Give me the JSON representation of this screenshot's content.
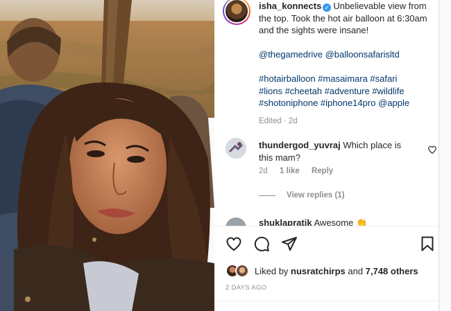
{
  "post": {
    "username": "isha_konnects",
    "verified_badge": "verified-badge-icon",
    "caption_text": "Unbelievable view from the top. Took the hot air balloon at 6:30am and the sights were insane!",
    "mentions": [
      "@thegamedrive",
      "@balloonsafarisltd"
    ],
    "hashtags_line1": "#hotairballoon #masaimara #safari",
    "hashtags_line2": "#lions #cheetah #adventure #wildlife",
    "hashtags_line3_tags": "#shotoniphone #iphone14pro",
    "hashtags_line3_mention": "@apple",
    "edited_meta": "Edited · 2d"
  },
  "comments": [
    {
      "username": "thundergod_yuvraj",
      "text": "Which place is this mam?",
      "age": "2d",
      "likes": "1 like",
      "reply_label": "Reply",
      "view_replies": "View replies (1)"
    },
    {
      "username": "shuklapratik",
      "text": "Awesome 👏"
    }
  ],
  "actions": {
    "like": "heart-icon",
    "comment": "comment-icon",
    "share": "share-icon",
    "save": "bookmark-icon"
  },
  "likes": {
    "prefix": "Liked by",
    "user": "nusratchirps",
    "connector": "and",
    "count": "7,748 others"
  },
  "timestamp": "2 DAYS AGO",
  "colors": {
    "link": "#00376b",
    "muted": "#8e8e8e",
    "verified": "#3897f0",
    "border": "#dbdbdb"
  }
}
